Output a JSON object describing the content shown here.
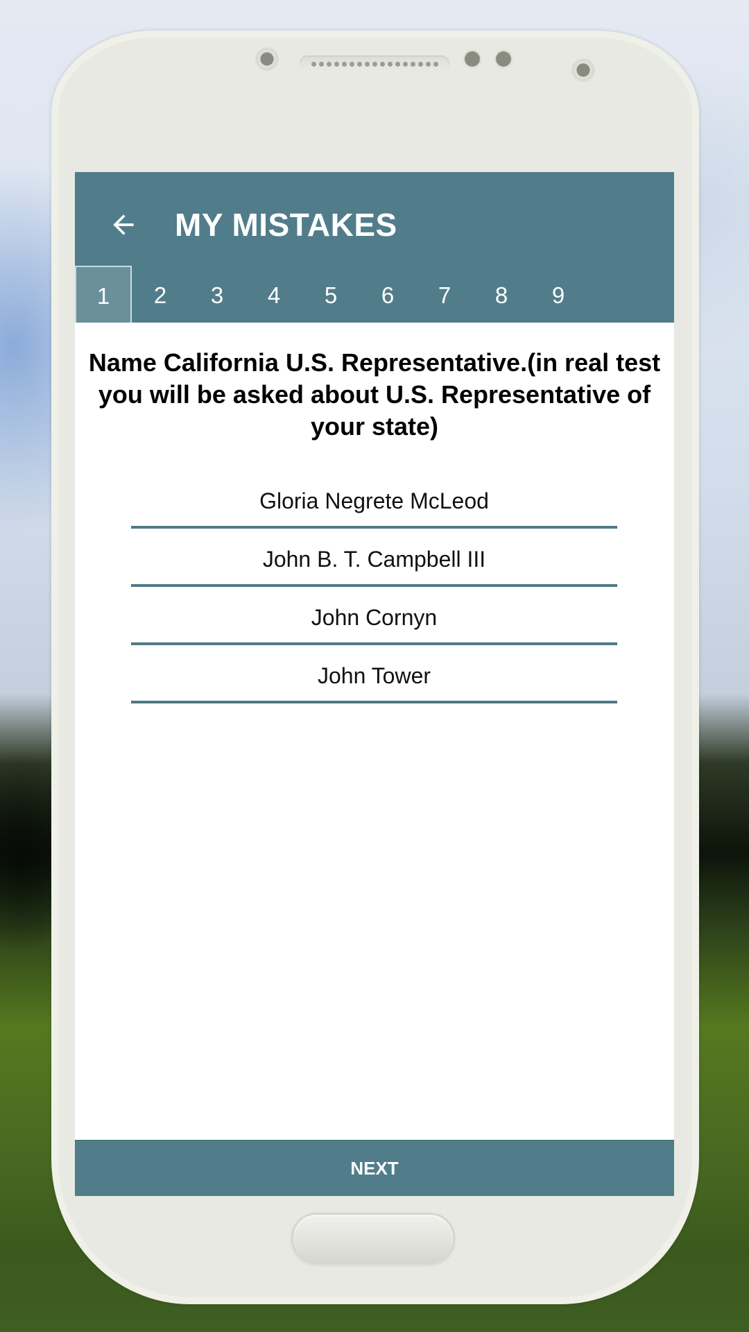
{
  "app_bar": {
    "back_icon": "arrow-left-icon",
    "title": "MY MISTAKES"
  },
  "tabs": [
    {
      "label": "1",
      "active": true
    },
    {
      "label": "2",
      "active": false
    },
    {
      "label": "3",
      "active": false
    },
    {
      "label": "4",
      "active": false
    },
    {
      "label": "5",
      "active": false
    },
    {
      "label": "6",
      "active": false
    },
    {
      "label": "7",
      "active": false
    },
    {
      "label": "8",
      "active": false
    },
    {
      "label": "9",
      "active": false
    }
  ],
  "question": {
    "text": "Name California U.S. Representative.(in real test you will be asked about U.S. Representative of your state)"
  },
  "options": [
    {
      "label": "Gloria Negrete McLeod"
    },
    {
      "label": "John B. T. Campbell III"
    },
    {
      "label": "John Cornyn"
    },
    {
      "label": "John Tower"
    }
  ],
  "footer": {
    "next_label": "NEXT"
  },
  "colors": {
    "primary": "#517d8b",
    "active_tab": "#6a909b",
    "divider": "#4f7987"
  }
}
